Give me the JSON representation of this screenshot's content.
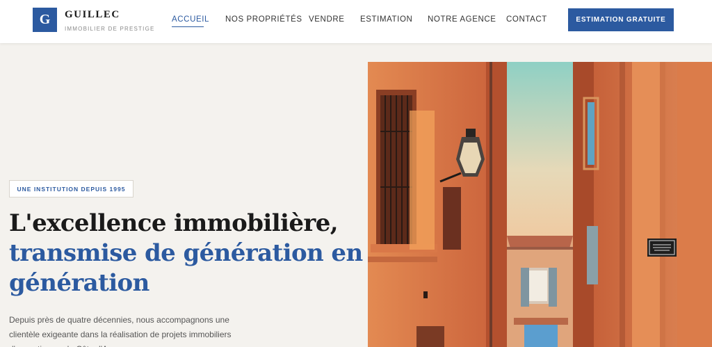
{
  "brand": {
    "logo_letter": "G",
    "name": "GUILLEC",
    "tagline": "IMMOBILIER DE PRESTIGE"
  },
  "nav": {
    "items": [
      {
        "label": "ACCUEIL",
        "active": true
      },
      {
        "label": "NOS PROPRIÉTÉS",
        "active": false
      },
      {
        "label": "VENDRE",
        "active": false
      },
      {
        "label": "ESTIMATION",
        "active": false
      },
      {
        "label": "NOTRE AGENCE",
        "active": false
      },
      {
        "label": "CONTACT",
        "active": false
      }
    ],
    "cta_label": "ESTIMATION GRATUITE"
  },
  "hero": {
    "badge": "UNE INSTITUTION DEPUIS 1995",
    "title_line1": "L'excellence immobilière,",
    "title_line2": "transmise de génération en",
    "title_line3": "génération",
    "lead": "Depuis près de quatre décennies, nous accompagnons une clientèle exigeante dans la réalisation de projets immobiliers d'exception sur la Côte d'Azur."
  },
  "colors": {
    "accent": "#2c5aa0",
    "background": "#f4f2ee"
  }
}
